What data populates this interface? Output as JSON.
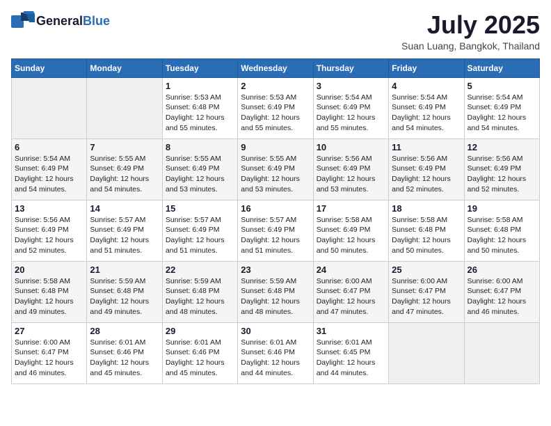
{
  "header": {
    "logo_general": "General",
    "logo_blue": "Blue",
    "month_title": "July 2025",
    "location": "Suan Luang, Bangkok, Thailand"
  },
  "days_of_week": [
    "Sunday",
    "Monday",
    "Tuesday",
    "Wednesday",
    "Thursday",
    "Friday",
    "Saturday"
  ],
  "weeks": [
    [
      {
        "day": "",
        "sunrise": "",
        "sunset": "",
        "daylight": ""
      },
      {
        "day": "",
        "sunrise": "",
        "sunset": "",
        "daylight": ""
      },
      {
        "day": "1",
        "sunrise": "Sunrise: 5:53 AM",
        "sunset": "Sunset: 6:48 PM",
        "daylight": "Daylight: 12 hours and 55 minutes."
      },
      {
        "day": "2",
        "sunrise": "Sunrise: 5:53 AM",
        "sunset": "Sunset: 6:49 PM",
        "daylight": "Daylight: 12 hours and 55 minutes."
      },
      {
        "day": "3",
        "sunrise": "Sunrise: 5:54 AM",
        "sunset": "Sunset: 6:49 PM",
        "daylight": "Daylight: 12 hours and 55 minutes."
      },
      {
        "day": "4",
        "sunrise": "Sunrise: 5:54 AM",
        "sunset": "Sunset: 6:49 PM",
        "daylight": "Daylight: 12 hours and 54 minutes."
      },
      {
        "day": "5",
        "sunrise": "Sunrise: 5:54 AM",
        "sunset": "Sunset: 6:49 PM",
        "daylight": "Daylight: 12 hours and 54 minutes."
      }
    ],
    [
      {
        "day": "6",
        "sunrise": "Sunrise: 5:54 AM",
        "sunset": "Sunset: 6:49 PM",
        "daylight": "Daylight: 12 hours and 54 minutes."
      },
      {
        "day": "7",
        "sunrise": "Sunrise: 5:55 AM",
        "sunset": "Sunset: 6:49 PM",
        "daylight": "Daylight: 12 hours and 54 minutes."
      },
      {
        "day": "8",
        "sunrise": "Sunrise: 5:55 AM",
        "sunset": "Sunset: 6:49 PM",
        "daylight": "Daylight: 12 hours and 53 minutes."
      },
      {
        "day": "9",
        "sunrise": "Sunrise: 5:55 AM",
        "sunset": "Sunset: 6:49 PM",
        "daylight": "Daylight: 12 hours and 53 minutes."
      },
      {
        "day": "10",
        "sunrise": "Sunrise: 5:56 AM",
        "sunset": "Sunset: 6:49 PM",
        "daylight": "Daylight: 12 hours and 53 minutes."
      },
      {
        "day": "11",
        "sunrise": "Sunrise: 5:56 AM",
        "sunset": "Sunset: 6:49 PM",
        "daylight": "Daylight: 12 hours and 52 minutes."
      },
      {
        "day": "12",
        "sunrise": "Sunrise: 5:56 AM",
        "sunset": "Sunset: 6:49 PM",
        "daylight": "Daylight: 12 hours and 52 minutes."
      }
    ],
    [
      {
        "day": "13",
        "sunrise": "Sunrise: 5:56 AM",
        "sunset": "Sunset: 6:49 PM",
        "daylight": "Daylight: 12 hours and 52 minutes."
      },
      {
        "day": "14",
        "sunrise": "Sunrise: 5:57 AM",
        "sunset": "Sunset: 6:49 PM",
        "daylight": "Daylight: 12 hours and 51 minutes."
      },
      {
        "day": "15",
        "sunrise": "Sunrise: 5:57 AM",
        "sunset": "Sunset: 6:49 PM",
        "daylight": "Daylight: 12 hours and 51 minutes."
      },
      {
        "day": "16",
        "sunrise": "Sunrise: 5:57 AM",
        "sunset": "Sunset: 6:49 PM",
        "daylight": "Daylight: 12 hours and 51 minutes."
      },
      {
        "day": "17",
        "sunrise": "Sunrise: 5:58 AM",
        "sunset": "Sunset: 6:49 PM",
        "daylight": "Daylight: 12 hours and 50 minutes."
      },
      {
        "day": "18",
        "sunrise": "Sunrise: 5:58 AM",
        "sunset": "Sunset: 6:48 PM",
        "daylight": "Daylight: 12 hours and 50 minutes."
      },
      {
        "day": "19",
        "sunrise": "Sunrise: 5:58 AM",
        "sunset": "Sunset: 6:48 PM",
        "daylight": "Daylight: 12 hours and 50 minutes."
      }
    ],
    [
      {
        "day": "20",
        "sunrise": "Sunrise: 5:58 AM",
        "sunset": "Sunset: 6:48 PM",
        "daylight": "Daylight: 12 hours and 49 minutes."
      },
      {
        "day": "21",
        "sunrise": "Sunrise: 5:59 AM",
        "sunset": "Sunset: 6:48 PM",
        "daylight": "Daylight: 12 hours and 49 minutes."
      },
      {
        "day": "22",
        "sunrise": "Sunrise: 5:59 AM",
        "sunset": "Sunset: 6:48 PM",
        "daylight": "Daylight: 12 hours and 48 minutes."
      },
      {
        "day": "23",
        "sunrise": "Sunrise: 5:59 AM",
        "sunset": "Sunset: 6:48 PM",
        "daylight": "Daylight: 12 hours and 48 minutes."
      },
      {
        "day": "24",
        "sunrise": "Sunrise: 6:00 AM",
        "sunset": "Sunset: 6:47 PM",
        "daylight": "Daylight: 12 hours and 47 minutes."
      },
      {
        "day": "25",
        "sunrise": "Sunrise: 6:00 AM",
        "sunset": "Sunset: 6:47 PM",
        "daylight": "Daylight: 12 hours and 47 minutes."
      },
      {
        "day": "26",
        "sunrise": "Sunrise: 6:00 AM",
        "sunset": "Sunset: 6:47 PM",
        "daylight": "Daylight: 12 hours and 46 minutes."
      }
    ],
    [
      {
        "day": "27",
        "sunrise": "Sunrise: 6:00 AM",
        "sunset": "Sunset: 6:47 PM",
        "daylight": "Daylight: 12 hours and 46 minutes."
      },
      {
        "day": "28",
        "sunrise": "Sunrise: 6:01 AM",
        "sunset": "Sunset: 6:46 PM",
        "daylight": "Daylight: 12 hours and 45 minutes."
      },
      {
        "day": "29",
        "sunrise": "Sunrise: 6:01 AM",
        "sunset": "Sunset: 6:46 PM",
        "daylight": "Daylight: 12 hours and 45 minutes."
      },
      {
        "day": "30",
        "sunrise": "Sunrise: 6:01 AM",
        "sunset": "Sunset: 6:46 PM",
        "daylight": "Daylight: 12 hours and 44 minutes."
      },
      {
        "day": "31",
        "sunrise": "Sunrise: 6:01 AM",
        "sunset": "Sunset: 6:45 PM",
        "daylight": "Daylight: 12 hours and 44 minutes."
      },
      {
        "day": "",
        "sunrise": "",
        "sunset": "",
        "daylight": ""
      },
      {
        "day": "",
        "sunrise": "",
        "sunset": "",
        "daylight": ""
      }
    ]
  ]
}
